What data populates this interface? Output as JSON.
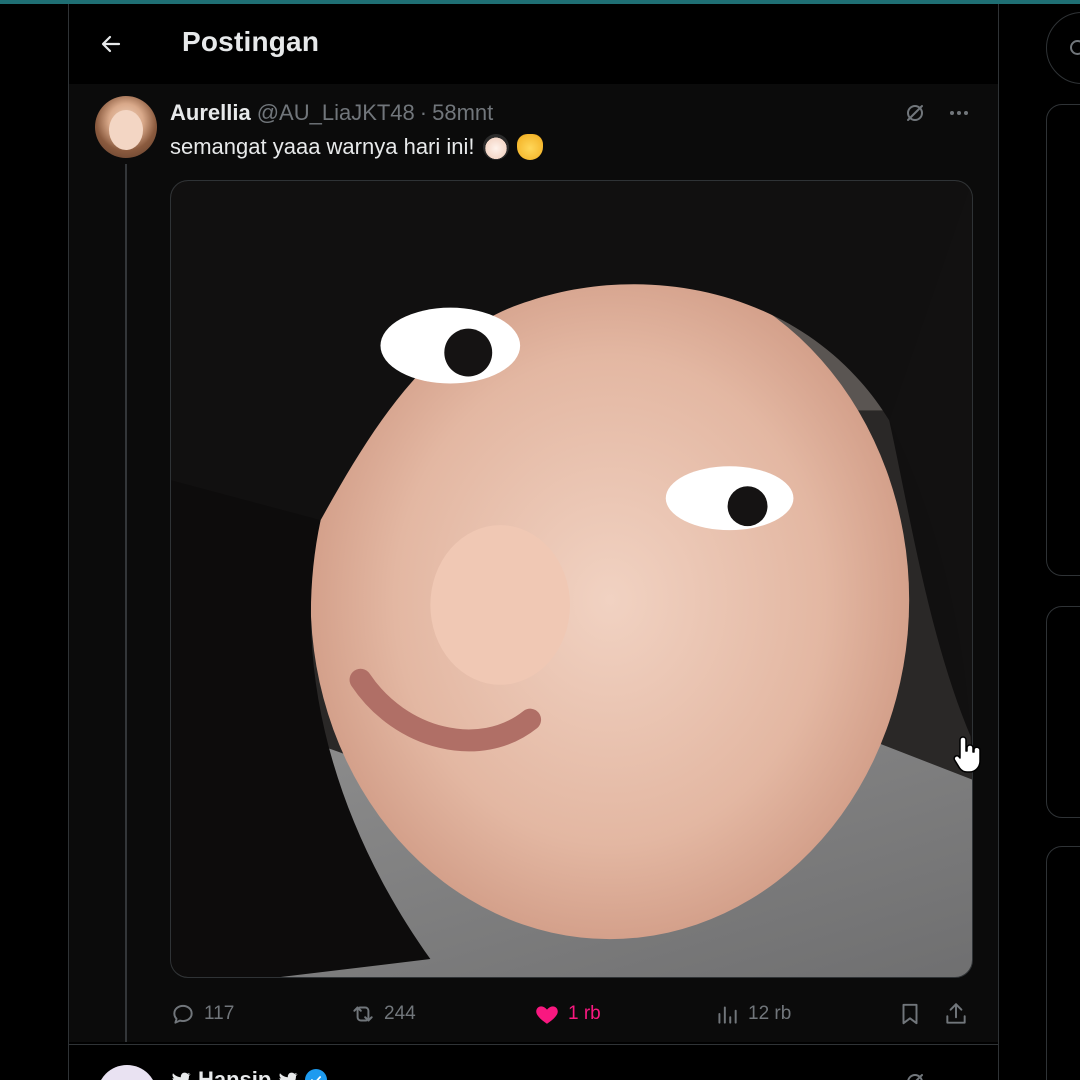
{
  "header": {
    "title": "Postingan"
  },
  "post": {
    "display_name": "Aurellia",
    "handle": "@AU_LiaJKT48",
    "separator": "·",
    "time": "58mnt",
    "text": "semangat yaaa warnya hari ini!",
    "emojis": [
      "face-emoji",
      "smirking-cat-emoji"
    ],
    "stats": {
      "replies": "117",
      "reposts": "244",
      "likes": "1 rb",
      "views": "12 rb"
    },
    "liked": true
  },
  "next_post": {
    "display_name": "Hansip"
  },
  "colors": {
    "background": "#000000",
    "post_background": "#0b0b0b",
    "text_primary": "#e7e9ea",
    "text_secondary": "#71767b",
    "like_active": "#f91880",
    "verified": "#1d9bf0",
    "border": "#2f3336",
    "top_accent": "#1f6f74"
  }
}
